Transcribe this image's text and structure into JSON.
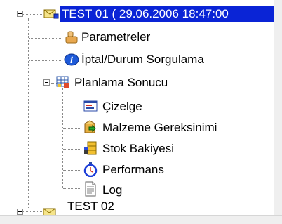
{
  "tree": {
    "root": {
      "label": "TEST 01  ( 29.06.2006 18:47:00",
      "icon": "envelope-flag-icon",
      "expanded": true,
      "selected": true,
      "children": [
        {
          "label": "Parametreler",
          "icon": "hand-icon"
        },
        {
          "label": "İptal/Durum Sorgulama",
          "icon": "info-icon"
        },
        {
          "label": "Planlama Sonucu",
          "icon": "planning-grid-icon",
          "expanded": true,
          "children": [
            {
              "label": "Çizelge",
              "icon": "schedule-window-icon"
            },
            {
              "label": "Malzeme Gereksinimi",
              "icon": "material-box-icon"
            },
            {
              "label": "Stok Bakiyesi",
              "icon": "stock-stack-icon"
            },
            {
              "label": "Performans",
              "icon": "stopwatch-icon"
            },
            {
              "label": "Log",
              "icon": "log-document-icon"
            }
          ]
        }
      ]
    },
    "next_root": {
      "label": "TEST 02",
      "icon": "envelope-icon",
      "expanded": false
    }
  },
  "colors": {
    "selection": "#0a24d6",
    "selection_text": "#ffffff",
    "connector": "#8a8a8a"
  }
}
